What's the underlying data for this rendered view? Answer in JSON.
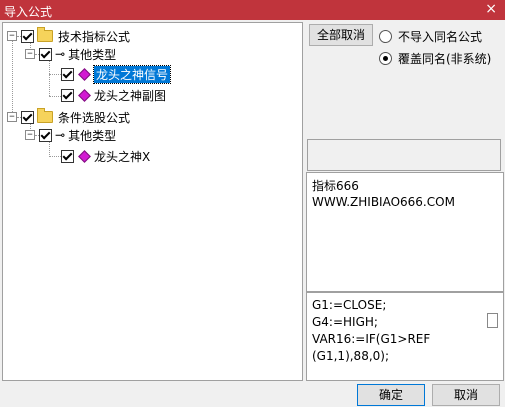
{
  "window": {
    "title": "导入公式",
    "close_glyph": "×"
  },
  "tree": {
    "groups": [
      {
        "label": "技术指标公式",
        "expander": "−",
        "subgroups": [
          {
            "label": "其他类型",
            "expander": "−",
            "items": [
              {
                "label": "龙头之神信号",
                "selected": true
              },
              {
                "label": "龙头之神副图",
                "selected": false
              }
            ]
          }
        ]
      },
      {
        "label": "条件选股公式",
        "expander": "−",
        "subgroups": [
          {
            "label": "其他类型",
            "expander": "−",
            "items": [
              {
                "label": "龙头之神X",
                "selected": false
              }
            ]
          }
        ]
      }
    ]
  },
  "buttons": {
    "deselect_all": "全部取消",
    "ok": "确定",
    "cancel": "取消"
  },
  "options": {
    "no_import_same_name": "不导入同名公式",
    "overwrite_same_name": "覆盖同名(非系统)",
    "selected": "overwrite_same_name"
  },
  "description": {
    "line1": "指标666",
    "line2": "WWW.ZHIBIAO666.COM"
  },
  "code": {
    "line1": "G1:=CLOSE;",
    "line2": "G4:=HIGH;",
    "line3": "VAR16:=IF(G1>REF",
    "line4": "(G1,1),88,0);"
  }
}
